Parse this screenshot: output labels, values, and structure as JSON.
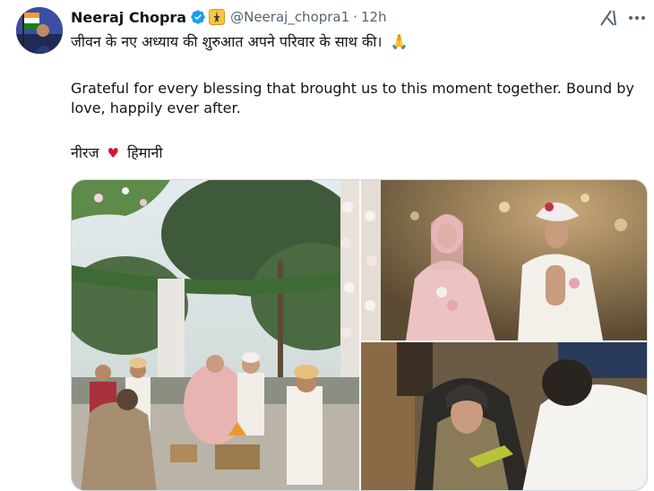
{
  "tweet": {
    "author_name": "Neeraj Chopra",
    "handle": "@Neeraj_chopra1",
    "separator": "·",
    "time": "12h",
    "line1": "जीवन के नए अध्याय की शुरुआत अपने परिवार के साथ की।",
    "line1_emoji": "🙏",
    "line2": "Grateful for every blessing that brought us to this moment together. Bound by love, happily ever after.",
    "sig_left": "नीरज",
    "sig_heart": "♥",
    "sig_right": "हिमानी"
  },
  "icons": {
    "verified": "verified-badge-icon",
    "affiliate": "affiliate-badge-icon",
    "grok": "grok-icon",
    "more": "more-icon"
  },
  "colors": {
    "verified_blue": "#1d9bf0",
    "heart_red": "#d1153a",
    "secondary_text": "#536471"
  }
}
